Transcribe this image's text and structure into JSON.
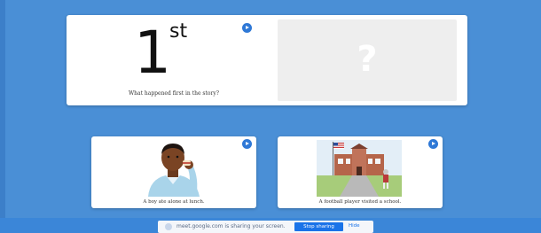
{
  "prompt": {
    "ordinal_number": "1",
    "ordinal_suffix": "st",
    "question": "What happened first in the story?",
    "placeholder_symbol": "?"
  },
  "options": [
    {
      "label": "A boy ate alone at lunch."
    },
    {
      "label": "A football player visited a school."
    }
  ],
  "share_bar": {
    "message": "meet.google.com is sharing your screen.",
    "stop_label": "Stop sharing",
    "hide_label": "Hide"
  },
  "colors": {
    "background": "#4a8fd6",
    "accent": "#2e78d6",
    "stop_button": "#1a73e8"
  },
  "icons": [
    "play-audio-icon",
    "screen-share-icon"
  ]
}
